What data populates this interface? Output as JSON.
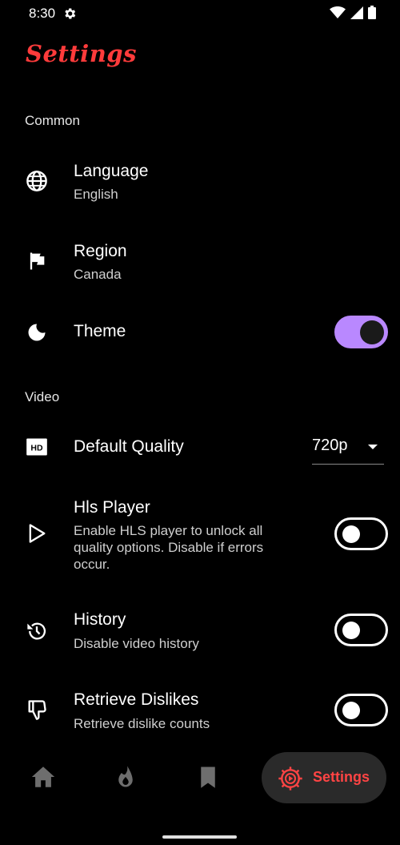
{
  "status_bar": {
    "time": "8:30"
  },
  "header": {
    "title": "Settings"
  },
  "sections": {
    "common": "Common",
    "video": "Video"
  },
  "settings": {
    "language": {
      "title": "Language",
      "value": "English"
    },
    "region": {
      "title": "Region",
      "value": "Canada"
    },
    "theme": {
      "title": "Theme",
      "enabled": true
    },
    "default_quality": {
      "title": "Default Quality",
      "value": "720p"
    },
    "hls_player": {
      "title": "Hls Player",
      "description": "Enable HLS player to unlock all quality options. Disable if errors occur.",
      "enabled": false
    },
    "history": {
      "title": "History",
      "description": "Disable video history",
      "enabled": false
    },
    "retrieve_dislikes": {
      "title": "Retrieve Dislikes",
      "description": "Retrieve dislike counts",
      "enabled": false
    }
  },
  "bottom_nav": {
    "items": [
      "home-icon",
      "trending-icon",
      "bookmark-icon",
      "settings-icon"
    ],
    "active_label": "Settings"
  },
  "colors": {
    "accent": "#ff3b3b",
    "toggle_on": "#b988ff",
    "background": "#000000"
  }
}
